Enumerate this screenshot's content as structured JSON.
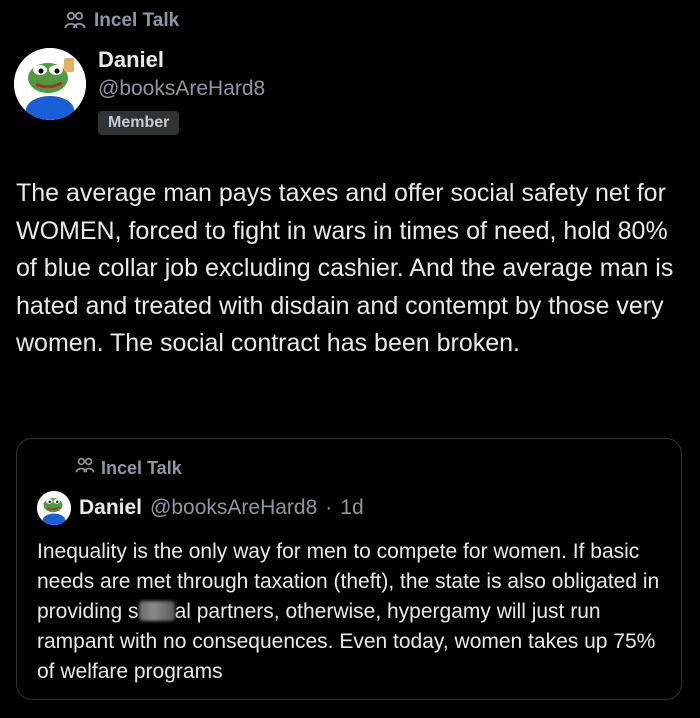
{
  "community": {
    "name": "Incel Talk",
    "icon": "community-people-icon"
  },
  "author": {
    "name": "Daniel",
    "handle": "@booksAreHard8",
    "badge": "Member",
    "avatar_icon": "frog-avatar"
  },
  "post": {
    "text": "The average man pays taxes and offer social safety net for WOMEN, forced to fight in wars in times of need, hold 80% of blue collar job excluding cashier. And the average man is hated and treated with disdain and contempt by those very women. The social contract has been broken."
  },
  "quote": {
    "community": "Incel Talk",
    "name": "Daniel",
    "handle": "@booksAreHard8",
    "separator": "·",
    "time": "1d",
    "text_part1": "Inequality is the only way for men to compete for women. If basic needs are met through taxation (theft), the state is also obligated in providing s",
    "text_part2": "al partners, otherwise, hypergamy will just run rampant with no consequences. Even today, women takes up 75% of welfare programs"
  },
  "colors": {
    "background": "#000000",
    "text": "#e7e9ea",
    "secondary": "#8b98a5",
    "border": "#2f3336"
  }
}
